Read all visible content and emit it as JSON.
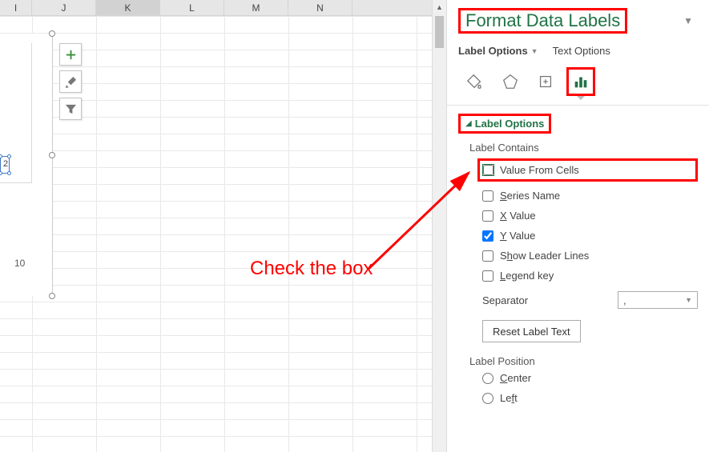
{
  "columns": [
    "I",
    "J",
    "K",
    "L",
    "M",
    "N"
  ],
  "selected_column_index": 2,
  "chart": {
    "tick_label": "10",
    "data_label": "2"
  },
  "chart_buttons": {
    "plus": "add-element",
    "brush": "chart-styles",
    "funnel": "chart-filters"
  },
  "pane": {
    "title": "Format Data Labels",
    "tabs": {
      "label_options": "Label Options",
      "text_options": "Text Options"
    },
    "section": "Label Options",
    "label_contains": "Label Contains",
    "options": {
      "value_from_cells": {
        "label_pre": "Value ",
        "u": "F",
        "label_post": "rom Cells",
        "checked": false
      },
      "series_name": {
        "u": "S",
        "label_post": "eries Name",
        "checked": false
      },
      "x_value": {
        "u": "X",
        "label_post": " Value",
        "checked": false
      },
      "y_value": {
        "u": "Y",
        "label_post": " Value",
        "checked": true
      },
      "leader_lines": {
        "label_pre": "S",
        "u": "h",
        "label_post": "ow Leader Lines",
        "checked": false
      },
      "legend_key": {
        "u": "L",
        "label_post": "egend key",
        "checked": false
      }
    },
    "separator": {
      "label_pre": "S",
      "u": "e",
      "label_post": "parator",
      "value": ","
    },
    "reset": {
      "u": "R",
      "label_post": "eset Label Text"
    },
    "label_position": {
      "heading": "Label Position",
      "center": {
        "u": "C",
        "label_post": "enter"
      },
      "left": {
        "label_pre": "Le",
        "u": "f",
        "label_post": "t"
      }
    }
  },
  "annotation": "Check the box"
}
